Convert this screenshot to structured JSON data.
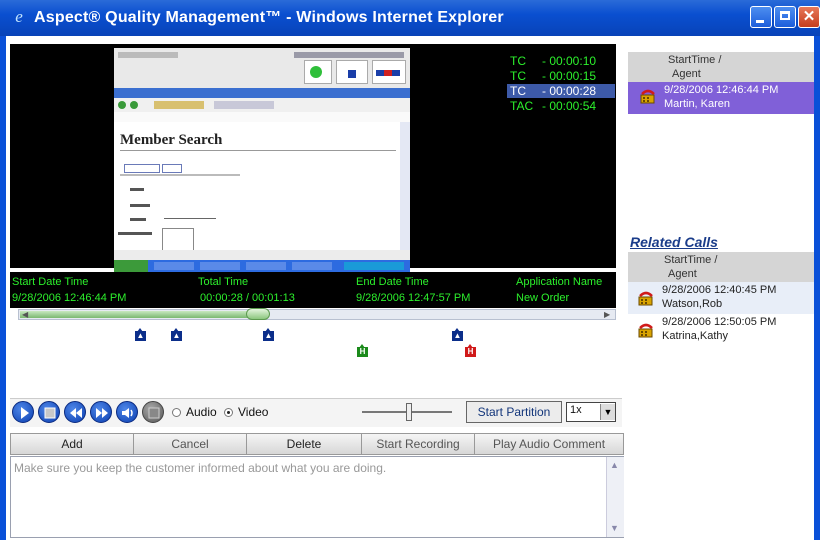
{
  "window": {
    "title": "Aspect® Quality Management™ - Windows Internet Explorer",
    "close_glyph": "✕"
  },
  "recording": {
    "page_heading": "Member Search",
    "timers": [
      {
        "label": "TC",
        "value": "- 00:00:10"
      },
      {
        "label": "TC",
        "value": "- 00:00:15"
      },
      {
        "label": "TC",
        "value": "- 00:00:28"
      },
      {
        "label": "TAC",
        "value": "- 00:00:54"
      }
    ],
    "info": {
      "start_label": "Start Date Time",
      "start_value": "9/28/2006 12:46:44 PM",
      "total_label": "Total Time",
      "total_value": "00:00:28 / 00:01:13",
      "end_label": "End Date Time",
      "end_value": "9/28/2006 12:47:57 PM",
      "app_label": "Application Name",
      "app_value": "New Order"
    },
    "progress": 0.41,
    "markers": [
      {
        "type": "blue",
        "char": "▲"
      },
      {
        "type": "blue",
        "char": "▲"
      },
      {
        "type": "blue",
        "char": "▲"
      },
      {
        "type": "green",
        "char": "H"
      },
      {
        "type": "blue",
        "char": "▲"
      },
      {
        "type": "red",
        "char": "H"
      }
    ]
  },
  "current_call": {
    "header_line1": "StartTime /",
    "header_line2": "Agent",
    "row": {
      "time": "9/28/2006 12:46:44 PM",
      "agent": "Martin, Karen"
    }
  },
  "related_calls": {
    "title": "Related Calls",
    "header_line1": "StartTime /",
    "header_line2": "Agent",
    "rows": [
      {
        "time": "9/28/2006 12:40:45 PM",
        "agent": "Watson,Rob"
      },
      {
        "time": "9/28/2006 12:50:05 PM",
        "agent": "Katrina,Kathy"
      }
    ]
  },
  "controls": {
    "audio_label": "Audio",
    "video_label": "Video",
    "selected_mode": "Video",
    "start_partition_label": "Start Partition",
    "speed_value": "1x",
    "dropdown_glyph": "▼"
  },
  "comment": {
    "add_label": "Add",
    "cancel_label": "Cancel",
    "delete_label": "Delete",
    "start_recording_label": "Start Recording",
    "play_audio_comment_label": "Play Audio Comment",
    "text": "Make sure you keep the customer informed about what you are doing."
  },
  "colors": {
    "timer_green": "#2cf02c",
    "selected_row": "#8060d8",
    "title_blue": "#0a4fd0",
    "link_blue": "#1a3c8a"
  }
}
